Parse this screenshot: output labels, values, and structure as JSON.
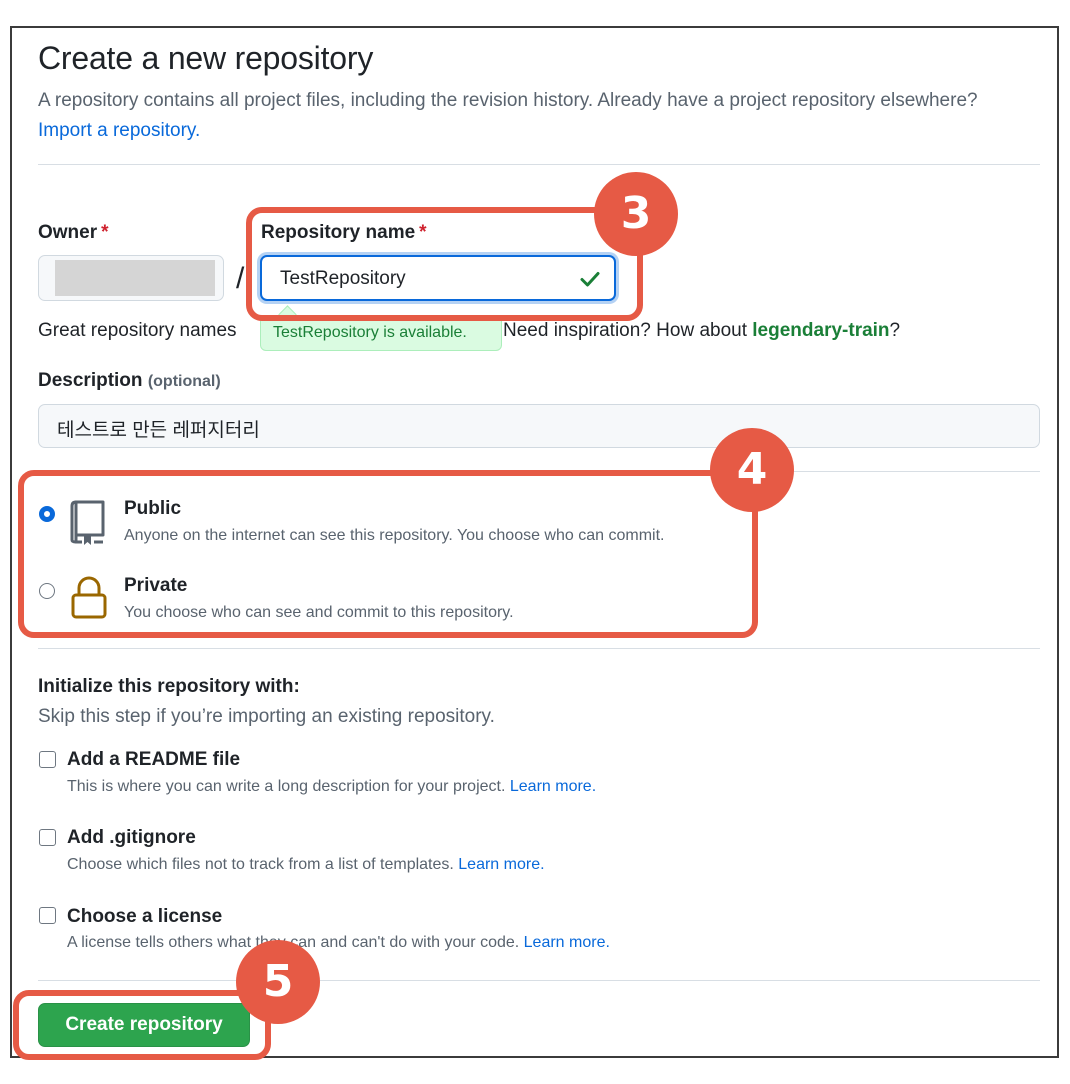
{
  "header": {
    "title": "Create a new repository",
    "subtitle": "A repository contains all project files, including the revision history. Already have a project repository elsewhere?",
    "import_link": "Import a repository."
  },
  "owner": {
    "label": "Owner",
    "required_mark": "*",
    "slash": "/"
  },
  "repo_name": {
    "label": "Repository name",
    "required_mark": "*",
    "value": "TestRepository",
    "availability": "TestRepository is available.",
    "hint_prefix": "Great repository names",
    "hint_middle": "Need inspiration? How about",
    "suggestion": "legendary-train",
    "hint_suffix": "?"
  },
  "description": {
    "label": "Description",
    "optional": "(optional)",
    "value": "테스트로 만든 레퍼지터리"
  },
  "visibility": {
    "public": {
      "title": "Public",
      "desc": "Anyone on the internet can see this repository. You choose who can commit.",
      "checked": true
    },
    "private": {
      "title": "Private",
      "desc": "You choose who can see and commit to this repository.",
      "checked": false
    }
  },
  "initialize": {
    "title": "Initialize this repository with:",
    "subtitle": "Skip this step if you’re importing an existing repository.",
    "readme": {
      "title": "Add a README file",
      "desc": "This is where you can write a long description for your project.",
      "link": "Learn more."
    },
    "gitignore": {
      "title": "Add .gitignore",
      "desc": "Choose which files not to track from a list of templates.",
      "link": "Learn more."
    },
    "license": {
      "title": "Choose a license",
      "desc": "A license tells others what they can and can't do with your code.",
      "link": "Learn more."
    }
  },
  "actions": {
    "create_label": "Create repository"
  },
  "annotations": {
    "step3": "3",
    "step4": "4",
    "step5": "5",
    "color": "#e65a45"
  },
  "colors": {
    "link": "#0969da",
    "success": "#1a7f37",
    "button": "#2da44e"
  }
}
